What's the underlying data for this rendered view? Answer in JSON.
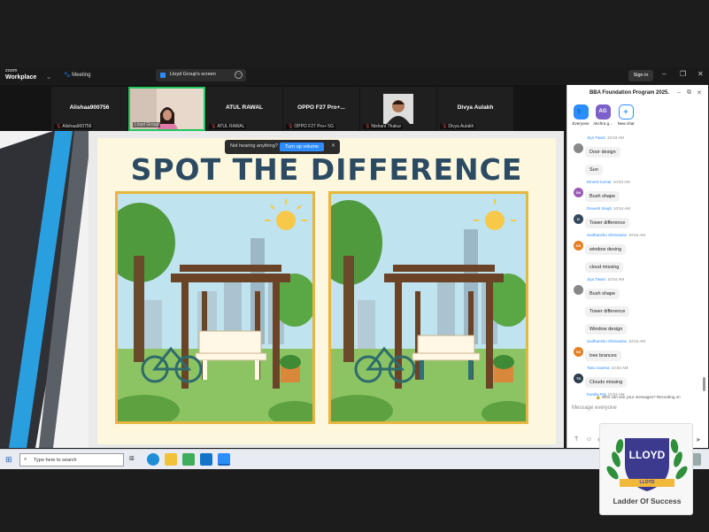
{
  "app": {
    "logo_top": "zoom",
    "logo_bottom": "Workplace",
    "meeting_tab": "Meeting",
    "screen_tab": "Lloyd Group's screen",
    "signin": "Sign in"
  },
  "participants": [
    {
      "name": "Alishaa900756",
      "label": "Alishaa900756"
    },
    {
      "name": "",
      "label": "Lloyd Group"
    },
    {
      "name": "ATUL RAWAL",
      "label": "ATUL RAWAL"
    },
    {
      "name": "OPPO F27 Pro+...",
      "label": "OPPO F27 Pro+ 5G"
    },
    {
      "name": "",
      "label": "Nishant Thakur"
    },
    {
      "name": "Divya Aulakh",
      "label": "Divya Aulakh"
    }
  ],
  "slide": {
    "title": "SPOT THE DIFFERENCE"
  },
  "toast": {
    "text": "Not hearing anything?",
    "button": "Turn up volume"
  },
  "chat": {
    "title": "BBA Foundation Program 2025.",
    "tabs": [
      {
        "label": "Everyone",
        "icon": "group-icon",
        "color": "#2d8cff"
      },
      {
        "label": "Akchra g...",
        "initials": "AG",
        "color": "#7b61c9"
      },
      {
        "label": "New chat",
        "icon": "plus-icon",
        "color": "#ffffff"
      }
    ],
    "messages": [
      {
        "sender": "Jiya Tiwari",
        "time": "10:53 AM",
        "initials": "",
        "color": "#888888",
        "texts": [
          "Door design",
          "Sun"
        ]
      },
      {
        "sender": "Dinesh kumar",
        "time": "10:53 AM",
        "initials": "DK",
        "color": "#9b59b6",
        "texts": [
          "Bush shape"
        ]
      },
      {
        "sender": "Devesh Singh",
        "time": "10:54 AM",
        "initials": "D",
        "color": "#34495e",
        "texts": [
          "Tower difference"
        ]
      },
      {
        "sender": "Sudhanshu Shrivastav",
        "time": "10:54 AM",
        "initials": "SS",
        "color": "#e67e22",
        "texts": [
          "window desing",
          "cloud missing"
        ]
      },
      {
        "sender": "Jiya Tiwari",
        "time": "10:54 AM",
        "initials": "",
        "color": "#888888",
        "texts": [
          "Bush shape",
          "Tower difference",
          "Window design"
        ]
      },
      {
        "sender": "Sudhanshu Shrivastav",
        "time": "10:54 AM",
        "initials": "SS",
        "color": "#e67e22",
        "texts": [
          "tree brances"
        ]
      },
      {
        "sender": "Tanu saxena",
        "time": "10:54 AM",
        "initials": "TS",
        "color": "#2c3e50",
        "texts": [
          "Clouds missing"
        ]
      },
      {
        "sender": "Kanika Pal",
        "time": "10:54 AM",
        "initials": "",
        "color": "#c0392b",
        "texts": [
          "+"
        ]
      }
    ],
    "notice": "Who can see your messages? Recording on",
    "input_placeholder": "Message everyone"
  },
  "taskbar": {
    "search_placeholder": "Type here to search"
  },
  "watermark": {
    "brand": "LLOYD",
    "tagline": "Ladder Of Success"
  }
}
